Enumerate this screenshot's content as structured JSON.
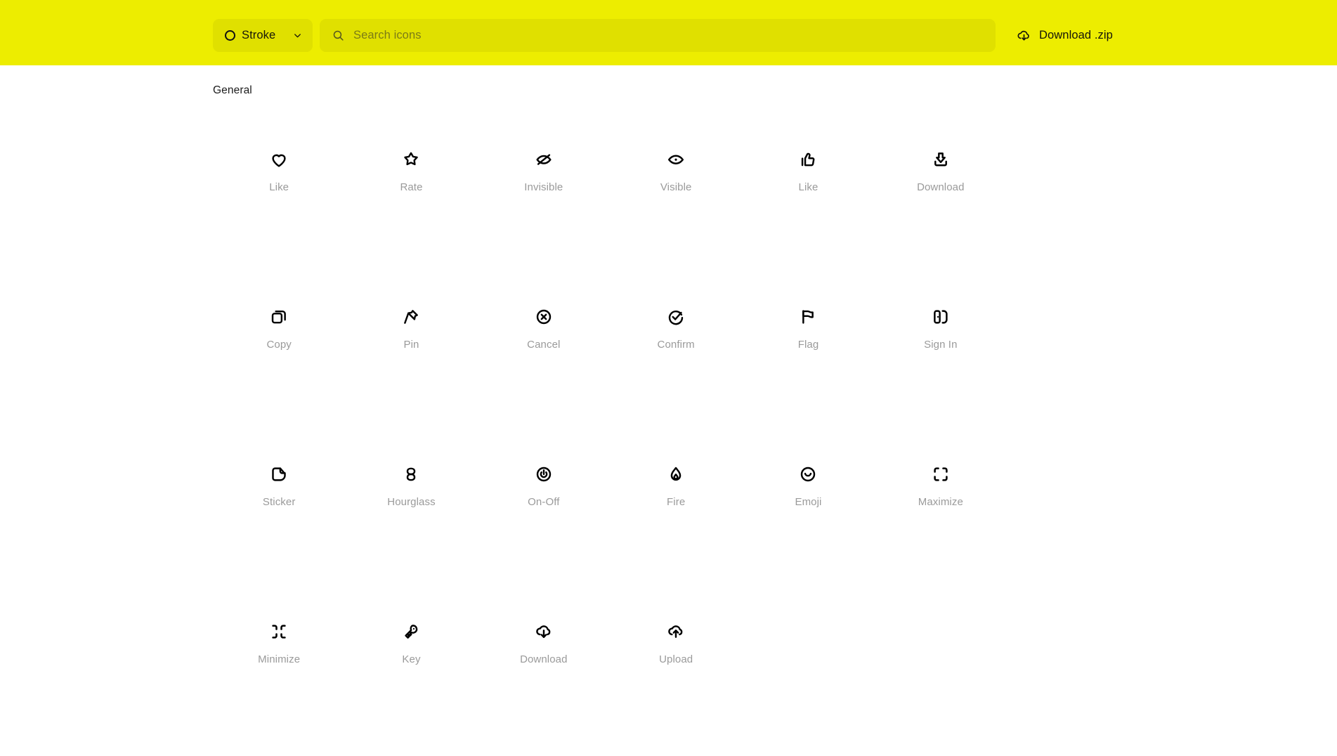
{
  "header": {
    "background_color": "#eded00",
    "style_select": {
      "icon": "circle-outline-icon",
      "value": "Stroke",
      "chevron": "chevron-down-icon"
    },
    "search": {
      "icon": "search-icon",
      "placeholder": "Search icons",
      "value": ""
    },
    "download": {
      "icon": "cloud-download-icon",
      "label": "Download .zip"
    }
  },
  "main": {
    "section_title": "General",
    "label_color": "#9a9a9a",
    "icons": [
      {
        "label": "Like",
        "icon": "heart-icon"
      },
      {
        "label": "Rate",
        "icon": "star-icon"
      },
      {
        "label": "Invisible",
        "icon": "eye-off-icon"
      },
      {
        "label": "Visible",
        "icon": "eye-icon"
      },
      {
        "label": "Like",
        "icon": "thumbs-up-icon"
      },
      {
        "label": "Download",
        "icon": "download-tray-icon"
      },
      {
        "label": "Copy",
        "icon": "copy-icon"
      },
      {
        "label": "Pin",
        "icon": "pin-icon"
      },
      {
        "label": "Cancel",
        "icon": "circle-x-icon"
      },
      {
        "label": "Confirm",
        "icon": "circle-check-icon"
      },
      {
        "label": "Flag",
        "icon": "flag-icon"
      },
      {
        "label": "Sign In",
        "icon": "sign-in-door-icon"
      },
      {
        "label": "Sticker",
        "icon": "sticker-page-icon"
      },
      {
        "label": "Hourglass",
        "icon": "hourglass-icon"
      },
      {
        "label": "On-Off",
        "icon": "power-icon"
      },
      {
        "label": "Fire",
        "icon": "fire-flame-icon"
      },
      {
        "label": "Emoji",
        "icon": "emoji-smiley-icon"
      },
      {
        "label": "Maximize",
        "icon": "maximize-corners-icon"
      },
      {
        "label": "Minimize",
        "icon": "minimize-corners-icon"
      },
      {
        "label": "Key",
        "icon": "key-icon"
      },
      {
        "label": "Download",
        "icon": "cloud-download-icon"
      },
      {
        "label": "Upload",
        "icon": "cloud-upload-icon"
      }
    ]
  }
}
